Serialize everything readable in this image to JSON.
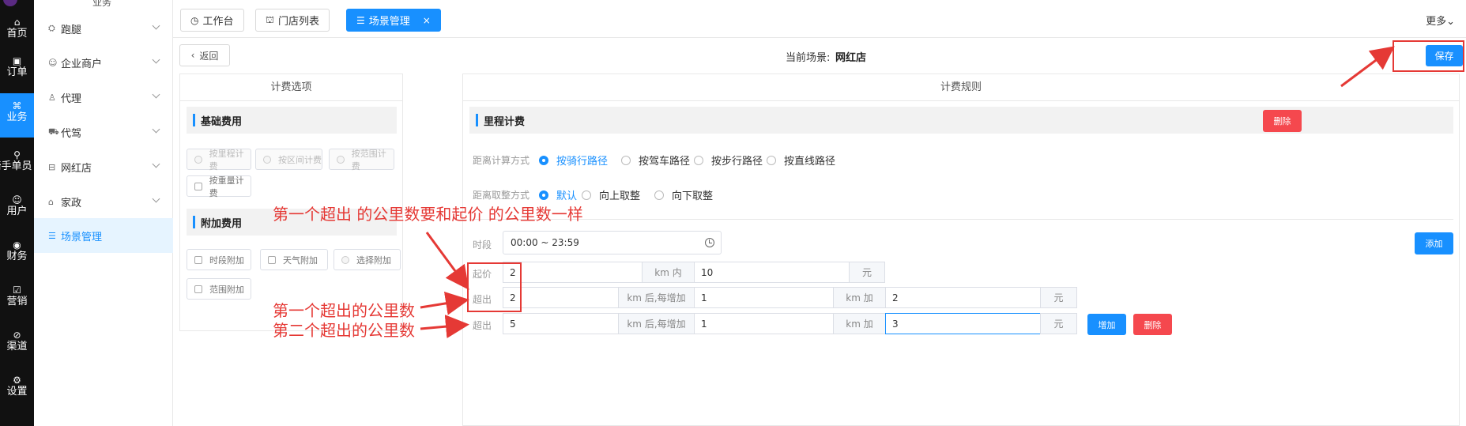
{
  "rail": {
    "items": [
      {
        "label": "首页",
        "icon": "home-icon",
        "glyph": "⌂"
      },
      {
        "label": "订单",
        "icon": "order-icon",
        "glyph": "▣"
      },
      {
        "label": "业务",
        "icon": "business-icon",
        "glyph": "⌘",
        "active": true
      },
      {
        "label": "骑手单员",
        "icon": "rider-icon",
        "glyph": "⚲"
      },
      {
        "label": "用户",
        "icon": "user-icon",
        "glyph": "☺"
      },
      {
        "label": "财务",
        "icon": "finance-icon",
        "glyph": "◉"
      },
      {
        "label": "营销",
        "icon": "marketing-icon",
        "glyph": "☑"
      },
      {
        "label": "渠道",
        "icon": "channel-icon",
        "glyph": "⊘"
      },
      {
        "label": "设置",
        "icon": "settings-icon",
        "glyph": "⚙"
      }
    ]
  },
  "submenu": {
    "title": "业务",
    "items": [
      {
        "label": "跑腿",
        "icon": "errand-icon",
        "glyph": "⛭"
      },
      {
        "label": "企业商户",
        "icon": "merchant-icon",
        "glyph": "☺"
      },
      {
        "label": "代理",
        "icon": "agent-icon",
        "glyph": "♙"
      },
      {
        "label": "代驾",
        "icon": "driver-icon",
        "glyph": "⛟"
      },
      {
        "label": "网红店",
        "icon": "store-icon",
        "glyph": "⊟"
      },
      {
        "label": "家政",
        "icon": "housekeeping-icon",
        "glyph": "⌂"
      },
      {
        "label": "场景管理",
        "icon": "scene-icon",
        "glyph": "☰",
        "active": true
      }
    ]
  },
  "tabs": [
    {
      "label": "工作台",
      "icon": "dashboard-icon",
      "glyph": "◷"
    },
    {
      "label": "门店列表",
      "icon": "shop-icon",
      "glyph": "⛫"
    },
    {
      "label": "场景管理",
      "icon": "scene-icon",
      "glyph": "☰",
      "active": true,
      "close": "×"
    }
  ],
  "more_label": "更多⌄",
  "header": {
    "back_label": "返回",
    "scene_label": "当前场景:",
    "scene_value": "网红店",
    "save_label": "保存"
  },
  "left_panel": {
    "title": "计费选项",
    "base_section": "基础费用",
    "base_options": [
      "按里程计费",
      "按区间计费",
      "按范围计费",
      "按重量计费"
    ],
    "extra_section": "附加费用",
    "extra_options": [
      "时段附加",
      "天气附加",
      "选择附加",
      "范围附加"
    ]
  },
  "right_panel": {
    "title": "计费规则",
    "mileage_section": "里程计费",
    "delete_label": "删除",
    "distance_calc_label": "距离计算方式",
    "distance_calc_options": [
      "按骑行路径",
      "按驾车路径",
      "按步行路径",
      "按直线路径"
    ],
    "distance_calc_selected": 0,
    "rounding_label": "距离取整方式",
    "rounding_options": [
      "默认",
      "向上取整",
      "向下取整"
    ],
    "rounding_selected": 0,
    "period_label": "时段",
    "period_value": "00:00 ~ 23:59",
    "add_label": "添加",
    "start_label": "起价",
    "start_km": "2",
    "km_within": "km 内",
    "start_price": "10",
    "yuan": "元",
    "excess_label": "超出",
    "rows": [
      {
        "km": "2",
        "per_km": "1",
        "price": "2"
      },
      {
        "km": "5",
        "per_km": "1",
        "price": "3"
      }
    ],
    "km_after_each": "km 后,每增加",
    "km_add": "km 加",
    "increase_label": "增加",
    "remove_label": "删除"
  },
  "annotations": {
    "note1": "第一个超出 的公里数要和起价 的公里数一样",
    "note2": "第一个超出的公里数",
    "note3": "第二个超出的公里数",
    "color": "#e53935"
  },
  "colors": {
    "primary": "#1890ff",
    "danger": "#f5484e",
    "rail": "#111111"
  }
}
